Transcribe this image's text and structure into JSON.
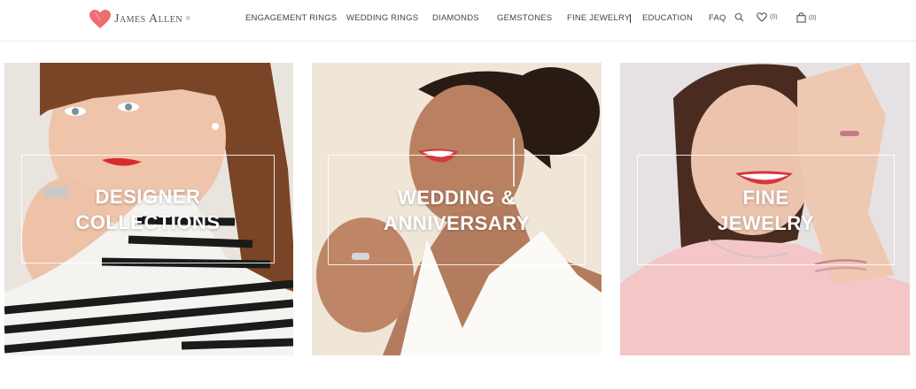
{
  "brand": {
    "name": "James Allen",
    "registered": "®"
  },
  "nav": {
    "items": [
      "ENGAGEMENT RINGS",
      "WEDDING RINGS",
      "DIAMONDS",
      "GEMSTONES",
      "FINE JEWELRY",
      "EDUCATION",
      "FAQ"
    ]
  },
  "utility": {
    "wishlist_count": "(0)",
    "cart_count": "(0)",
    "icons": [
      "search-icon",
      "heart-icon",
      "shopping-bag-icon"
    ]
  },
  "cards": [
    {
      "title": "DESIGNER\nCOLLECTIONS"
    },
    {
      "title": "WEDDING &\nANNIVERSARY"
    },
    {
      "title": "FINE\nJEWELRY"
    }
  ],
  "colors": {
    "brand_heart": "#ee6d6d",
    "overlay_text": "#ffffff"
  }
}
